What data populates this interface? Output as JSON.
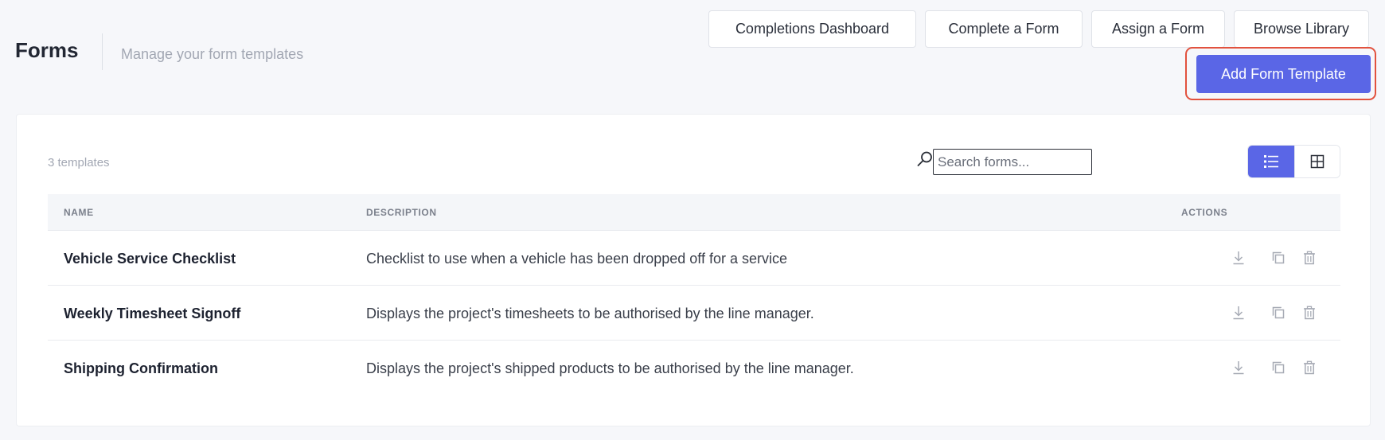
{
  "header": {
    "title": "Forms",
    "subtitle": "Manage your form templates",
    "buttons": {
      "dashboard": "Completions Dashboard",
      "complete": "Complete a Form",
      "assign": "Assign a Form",
      "browse": "Browse Library",
      "add": "Add Form Template"
    }
  },
  "panel": {
    "count": "3 templates",
    "search": {
      "placeholder": "Search forms...",
      "value": ""
    },
    "icons": {
      "search": "search-icon",
      "list_view": "list-view-icon",
      "grid_view": "grid-view-icon"
    }
  },
  "table": {
    "columns": {
      "name": "NAME",
      "description": "DESCRIPTION",
      "actions": "ACTIONS"
    },
    "rows": [
      {
        "name": "Vehicle Service Checklist",
        "description": "Checklist to use when a vehicle has been dropped off for a service"
      },
      {
        "name": "Weekly Timesheet Signoff",
        "description": "Displays the project's timesheets to be authorised by the line manager."
      },
      {
        "name": "Shipping Confirmation",
        "description": "Displays the project's shipped products to be authorised by the line manager."
      }
    ]
  },
  "colors": {
    "accent": "#5a66e6",
    "highlight": "#e2523e",
    "background": "#f6f7fa"
  }
}
